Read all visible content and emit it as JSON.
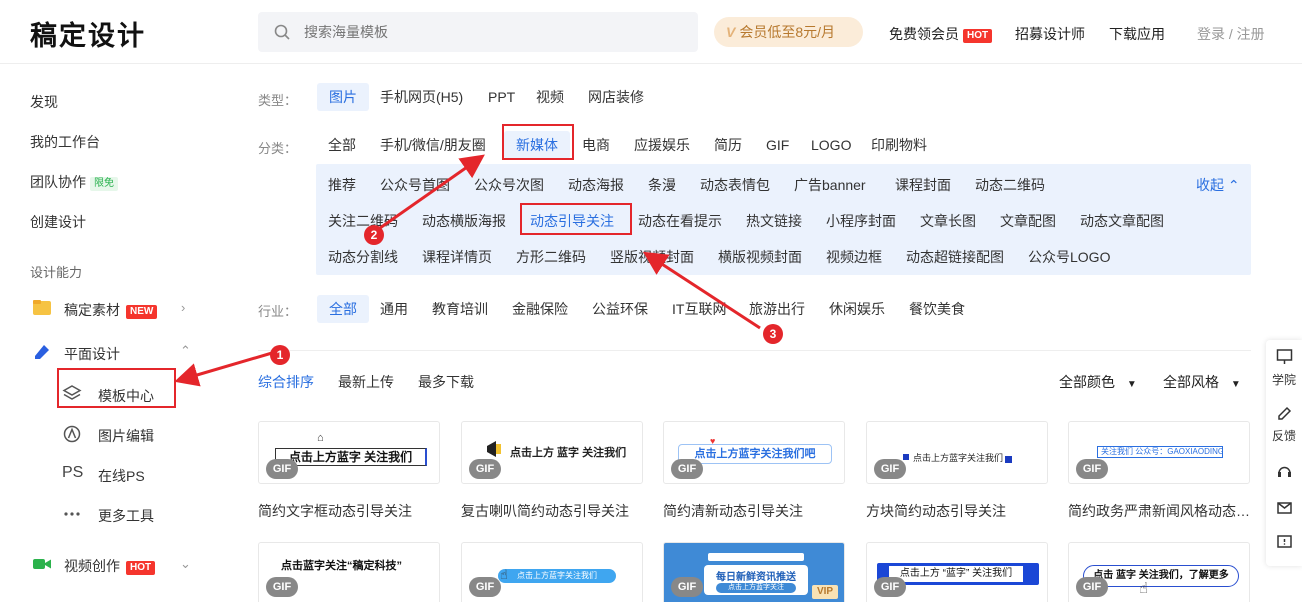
{
  "header": {
    "logo": "稿定设计",
    "search_placeholder": "搜索海量模板",
    "vip_label": "会员低至8元/月",
    "vip_mark": "V",
    "free_vip": "免费领会员",
    "hot_badge": "HOT",
    "recruit": "招募设计师",
    "download_app": "下载应用",
    "login": "登录 / 注册"
  },
  "sidebar": {
    "discover": "发现",
    "workspace": "我的工作台",
    "team": "团队协作",
    "team_badge": "限免",
    "create": "创建设计",
    "section_title": "设计能力",
    "materials": "稿定素材",
    "new_badge": "NEW",
    "graphic_design": "平面设计",
    "template_center": "模板中心",
    "image_edit": "图片编辑",
    "online_ps": "在线PS",
    "ps_mark": "PS",
    "more_tools": "更多工具",
    "video": "视频创作",
    "hot_badge": "HOT"
  },
  "filters": {
    "type_label": "类型：",
    "types": [
      "图片",
      "手机网页(H5)",
      "PPT",
      "视频",
      "网店装修"
    ],
    "category_label": "分类：",
    "categories": [
      "全部",
      "手机/微信/朋友圈",
      "新媒体",
      "电商",
      "应援娱乐",
      "简历",
      "GIF",
      "LOGO",
      "印刷物料"
    ],
    "subcategories_row1": [
      "推荐",
      "公众号首图",
      "公众号次图",
      "动态海报",
      "条漫",
      "动态表情包",
      "广告banner",
      "课程封面",
      "动态二维码"
    ],
    "subcategories_row2": [
      "关注二维码",
      "动态横版海报",
      "动态引导关注",
      "动态在看提示",
      "热文链接",
      "小程序封面",
      "文章长图",
      "文章配图",
      "动态文章配图"
    ],
    "subcategories_row3": [
      "动态分割线",
      "课程详情页",
      "方形二维码",
      "竖版视频封面",
      "横版视频封面",
      "视频边框",
      "动态超链接配图",
      "公众号LOGO"
    ],
    "collapse": "收起",
    "industry_label": "行业：",
    "industries": [
      "全部",
      "通用",
      "教育培训",
      "金融保险",
      "公益环保",
      "IT互联网",
      "旅游出行",
      "休闲娱乐",
      "餐饮美食"
    ]
  },
  "sort": {
    "options": [
      "综合排序",
      "最新上传",
      "最多下载"
    ],
    "color": "全部颜色",
    "style": "全部风格"
  },
  "cards_row1": [
    {
      "title": "简约文字框动态引导关注",
      "art": "点击上方蓝字 关注我们",
      "tag": "GIF"
    },
    {
      "title": "复古喇叭简约动态引导关注",
      "art": "点击上方 蓝字 关注我们",
      "tag": "GIF"
    },
    {
      "title": "简约清新动态引导关注",
      "art": "点击上方蓝字关注我们吧",
      "tag": "GIF"
    },
    {
      "title": "方块简约动态引导关注",
      "art": "点击上方蓝字关注我们",
      "tag": "GIF"
    },
    {
      "title": "简约政务严肃新闻风格动态引导关注",
      "art": "关注我们  公众号：GAOXIAODING",
      "tag": "GIF"
    }
  ],
  "cards_row2": [
    {
      "art": "点击蓝字关注“稿定科技”",
      "tag": "GIF"
    },
    {
      "art": "点击上方蓝字关注我们",
      "tag": "GIF"
    },
    {
      "art": "每日新鲜资讯推送",
      "art2": "点击上方蓝字关注",
      "vip": "VIP",
      "tag": "GIF"
    },
    {
      "art": "点击上方 “蓝字” 关注我们",
      "tag": "GIF"
    },
    {
      "art": "点击 蓝字 关注我们，了解更多",
      "tag": "GIF"
    }
  ],
  "right_bar": {
    "academy": "学院",
    "feedback": "反馈"
  },
  "annotations": [
    "1",
    "2",
    "3"
  ],
  "colors": {
    "accent": "#2a6fe0",
    "annotation": "#e4262b",
    "hot": "#f5352d"
  }
}
